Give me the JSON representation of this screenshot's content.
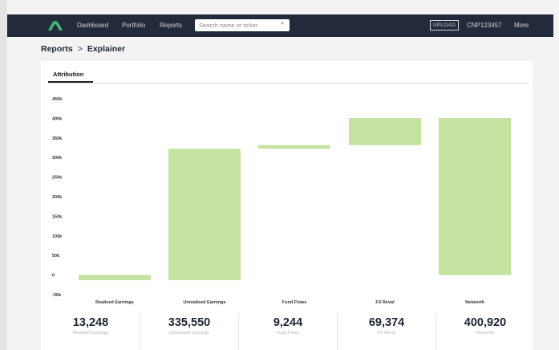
{
  "nav": {
    "items": [
      "Dashboard",
      "Portfolio",
      "Reports"
    ],
    "search_placeholder": "Search name or ticker",
    "upload_label": "UPLOAD",
    "account": "CNP123457",
    "more": "More"
  },
  "breadcrumb": {
    "parent": "Reports",
    "separator": ">",
    "current": "Explainer"
  },
  "tabs": [
    "Attribution"
  ],
  "colors": {
    "topbar": "#232a3c",
    "bar": "#c5e2a0",
    "logo": "#3fb36b"
  },
  "chart_data": {
    "type": "bar",
    "subtype": "waterfall",
    "categories": [
      "Realised Earnings",
      "Unrealised Earnings",
      "Fund Flows",
      "FX Reval",
      "Networth"
    ],
    "bars": [
      {
        "start": 0,
        "end": -13248
      },
      {
        "start": -13248,
        "end": 322302
      },
      {
        "start": 322302,
        "end": 331546
      },
      {
        "start": 331546,
        "end": 400920
      },
      {
        "start": 0,
        "end": 400920
      }
    ],
    "ylim": [
      -50000,
      450000
    ],
    "yticks": [
      "-50k",
      "0",
      "50k",
      "100k",
      "150k",
      "200k",
      "250k",
      "300k",
      "350k",
      "400k",
      "450k"
    ],
    "grid": false
  },
  "stats": [
    {
      "value": "13,248",
      "label": "Realised Earnings"
    },
    {
      "value": "335,550",
      "label": "Unrealised Earnings"
    },
    {
      "value": "9,244",
      "label": "Fund Flows"
    },
    {
      "value": "69,374",
      "label": "FX Reval"
    },
    {
      "value": "400,920",
      "label": "Networth"
    }
  ]
}
